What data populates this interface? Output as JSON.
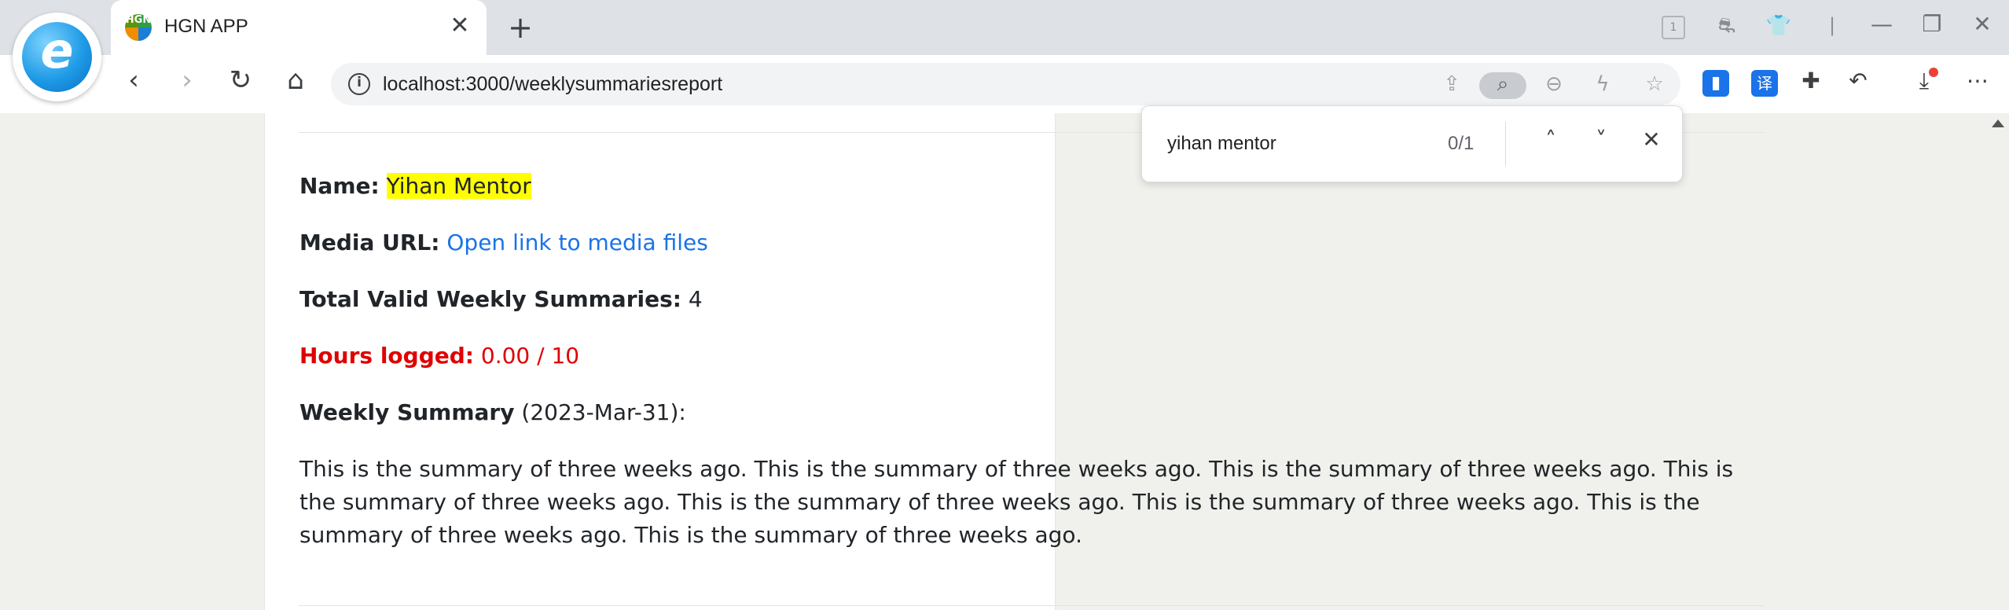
{
  "browser": {
    "tab_title": "HGN APP",
    "favicon_text": "HGN",
    "url": "localhost:3000/weeklysummariesreport",
    "tab_count_badge": "1"
  },
  "find_bar": {
    "query": "yihan mentor",
    "match_count": "0/1"
  },
  "report": {
    "name_label": "Name:",
    "name_value": "Yihan Mentor",
    "media_label": "Media URL:",
    "media_link": "Open link to media files",
    "total_label": "Total Valid Weekly Summaries:",
    "total_value": "4",
    "hours_label": "Hours logged:",
    "hours_value": "0.00 / 10",
    "summary_label": "Weekly Summary",
    "summary_date": "(2023-Mar-31):",
    "summary_text": "This is the summary of three weeks ago. This is the summary of three weeks ago. This is the summary of three weeks ago. This is the summary of three weeks ago. This is the summary of three weeks ago. This is the summary of three weeks ago. This is the summary of three weeks ago. This is the summary of three weeks ago."
  },
  "colors": {
    "highlight": "#ffff00",
    "link": "#1a73e8",
    "hours_red": "#e00000"
  }
}
